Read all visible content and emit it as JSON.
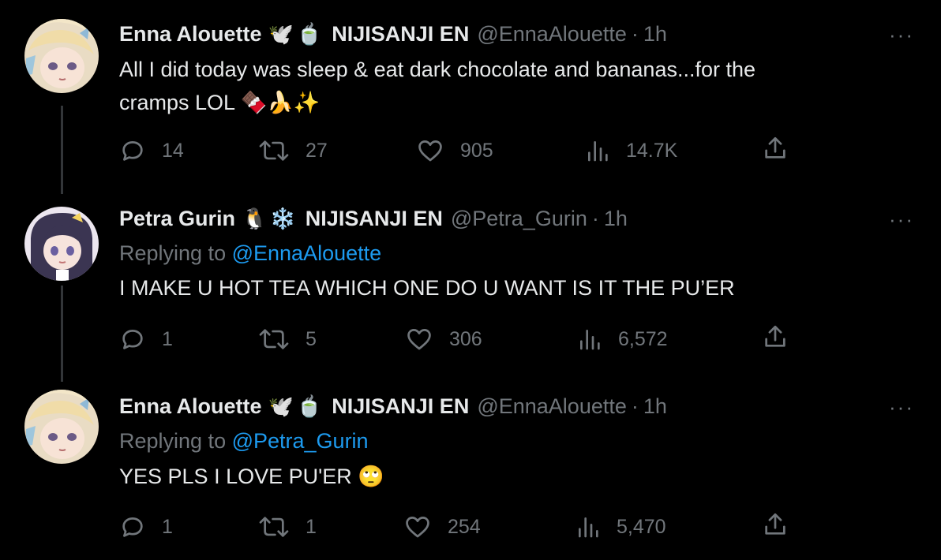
{
  "tweets": [
    {
      "name": "Enna Alouette",
      "badges": [
        "🕊️",
        "🍵"
      ],
      "org": "NIJISANJI EN",
      "handle": "@EnnaAlouette",
      "separator": "·",
      "time": "1h",
      "more": "···",
      "replying_label": "",
      "replying_to": "",
      "text_line1": "All I did today was sleep & eat dark chocolate and bananas...for the",
      "text_line2": "cramps LOL 🍫🍌✨",
      "replies": "14",
      "retweets": "27",
      "likes": "905",
      "views": "14.7K"
    },
    {
      "name": "Petra Gurin",
      "badges": [
        "🐧",
        "❄️"
      ],
      "org": "NIJISANJI EN",
      "handle": "@Petra_Gurin",
      "separator": "·",
      "time": "1h",
      "more": "···",
      "replying_label": "Replying to ",
      "replying_to": "@EnnaAlouette",
      "text_line1": "I MAKE U HOT TEA WHICH ONE DO U WANT IS IT THE PU’ER",
      "text_line2": "",
      "replies": "1",
      "retweets": "5",
      "likes": "306",
      "views": "6,572"
    },
    {
      "name": "Enna Alouette",
      "badges": [
        "🕊️",
        "🍵"
      ],
      "org": "NIJISANJI EN",
      "handle": "@EnnaAlouette",
      "separator": "·",
      "time": "1h",
      "more": "···",
      "replying_label": "Replying to ",
      "replying_to": "@Petra_Gurin",
      "text_line1": "YES PLS I LOVE PU'ER 🙄",
      "text_line2": "",
      "replies": "1",
      "retweets": "1",
      "likes": "254",
      "views": "5,470"
    }
  ],
  "icons": {
    "reply": "reply-icon",
    "retweet": "retweet-icon",
    "like": "heart-icon",
    "views": "views-icon",
    "share": "share-icon"
  },
  "colors": {
    "background": "#000000",
    "text": "#e7e9ea",
    "muted": "#71767b",
    "link": "#1d9bf0",
    "thread_line": "#333639"
  }
}
